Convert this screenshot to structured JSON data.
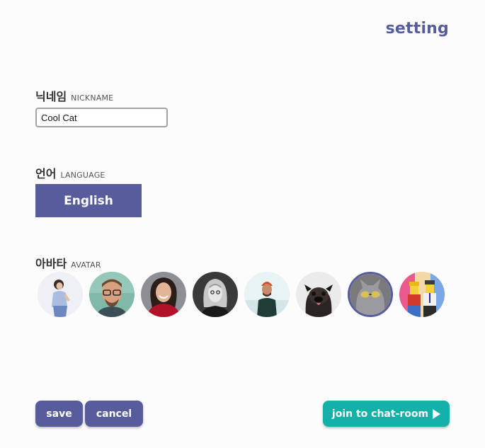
{
  "header": {
    "title": "setting"
  },
  "nickname": {
    "label_ko": "닉네임",
    "label_en": "NICKNAME",
    "value": "Cool Cat"
  },
  "language": {
    "label_ko": "언어",
    "label_en": "LANGUAGE",
    "selected": "English"
  },
  "avatar": {
    "label_ko": "아바타",
    "label_en": "AVATAR",
    "items": [
      {
        "name": "woman-standing-avatar",
        "selected": false
      },
      {
        "name": "man-glasses-avatar",
        "selected": false
      },
      {
        "name": "woman-smiling-avatar",
        "selected": false
      },
      {
        "name": "woman-monochrome-avatar",
        "selected": false
      },
      {
        "name": "man-beanie-avatar",
        "selected": false
      },
      {
        "name": "pug-avatar",
        "selected": false
      },
      {
        "name": "cat-sunglasses-avatar",
        "selected": true
      },
      {
        "name": "lego-figures-avatar",
        "selected": false
      }
    ]
  },
  "actions": {
    "save_label": "save",
    "cancel_label": "cancel",
    "join_label": "join to chat-room"
  },
  "colors": {
    "primary": "#575d9c",
    "accent": "#13b1a8",
    "background": "#fdfcfd"
  }
}
